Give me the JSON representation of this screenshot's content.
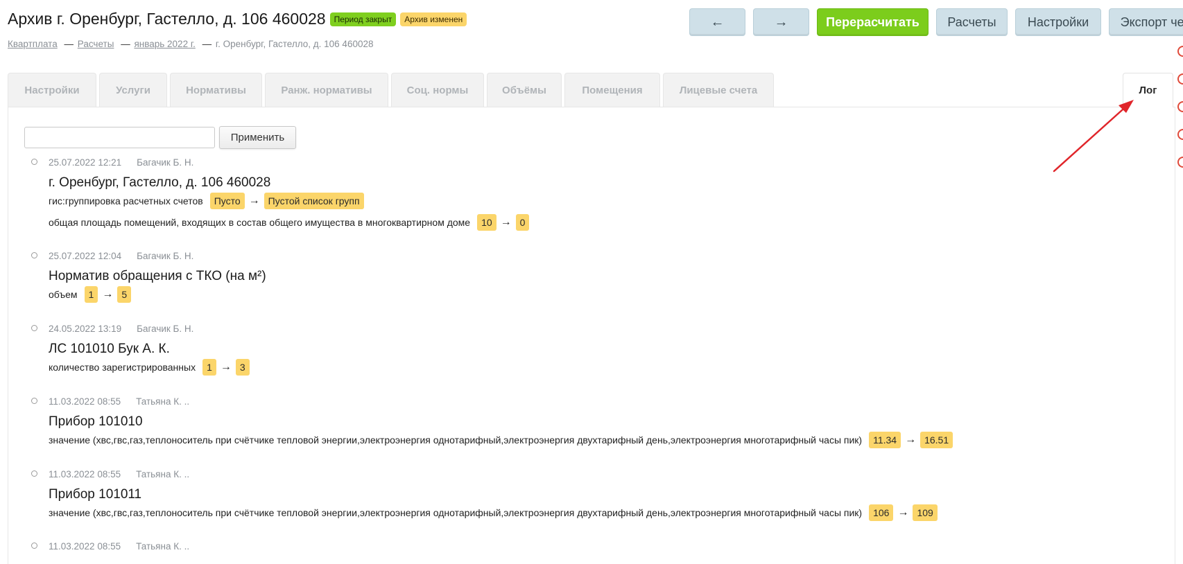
{
  "header": {
    "title": "Архив г. Оренбург, Гастелло, д. 106 460028",
    "badge_closed": "Период закрыт",
    "badge_changed": "Архив изменен",
    "colors": {
      "green": "#7fcf1f",
      "yellow": "#fbd56a"
    }
  },
  "breadcrumb": {
    "items": [
      "Квартплата",
      "Расчеты",
      "январь 2022 г."
    ],
    "current": "г. Оренбург, Гастелло, д. 106 460028",
    "separator": "—"
  },
  "toolbar": {
    "prev": "←",
    "next": "→",
    "recalc": "Перерасчитать",
    "calcs": "Расчеты",
    "settings": "Настройки",
    "export": "Экспорт чеков"
  },
  "tabs": [
    "Настройки",
    "Услуги",
    "Нормативы",
    "Ранж. нормативы",
    "Соц. нормы",
    "Объёмы",
    "Помещения",
    "Лицевые счета"
  ],
  "active_tab": "Лог",
  "filter": {
    "value": "",
    "placeholder": "",
    "apply": "Применить"
  },
  "arrow_symbol": "→",
  "log": [
    {
      "datetime": "25.07.2022 12:21",
      "author": "Багачик Б. Н.",
      "title": "г. Оренбург, Гастелло, д. 106 460028",
      "changes": [
        {
          "field": "гис:группировка расчетных счетов",
          "from": "Пусто",
          "to": "Пустой список групп"
        },
        {
          "field": "общая площадь помещений, входящих в состав общего имущества в многоквартирном доме",
          "from": "10",
          "to": "0"
        }
      ]
    },
    {
      "datetime": "25.07.2022 12:04",
      "author": "Багачик Б. Н.",
      "title": "Норматив обращения с ТКО (на м²)",
      "changes": [
        {
          "field": "объем",
          "from": "1",
          "to": "5"
        }
      ]
    },
    {
      "datetime": "24.05.2022 13:19",
      "author": "Багачик Б. Н.",
      "title": "ЛС 101010 Бук А. К.",
      "changes": [
        {
          "field": "количество зарегистрированных",
          "from": "1",
          "to": "3"
        }
      ]
    },
    {
      "datetime": "11.03.2022 08:55",
      "author": "Татьяна К. ..",
      "title": "Прибор 101010",
      "changes": [
        {
          "field": "значение (хвс,гвс,газ,теплоноситель при счётчике тепловой энергии,электроэнергия однотарифный,электроэнергия двухтарифный день,электроэнергия многотарифный часы пик)",
          "from": "11.34",
          "to": "16.51"
        }
      ]
    },
    {
      "datetime": "11.03.2022 08:55",
      "author": "Татьяна К. ..",
      "title": "Прибор 101011",
      "changes": [
        {
          "field": "значение (хвс,гвс,газ,теплоноситель при счётчике тепловой энергии,электроэнергия однотарифный,электроэнергия двухтарифный день,электроэнергия многотарифный часы пик)",
          "from": "106",
          "to": "109"
        }
      ]
    },
    {
      "datetime": "11.03.2022 08:55",
      "author": "Татьяна К. .."
    }
  ]
}
